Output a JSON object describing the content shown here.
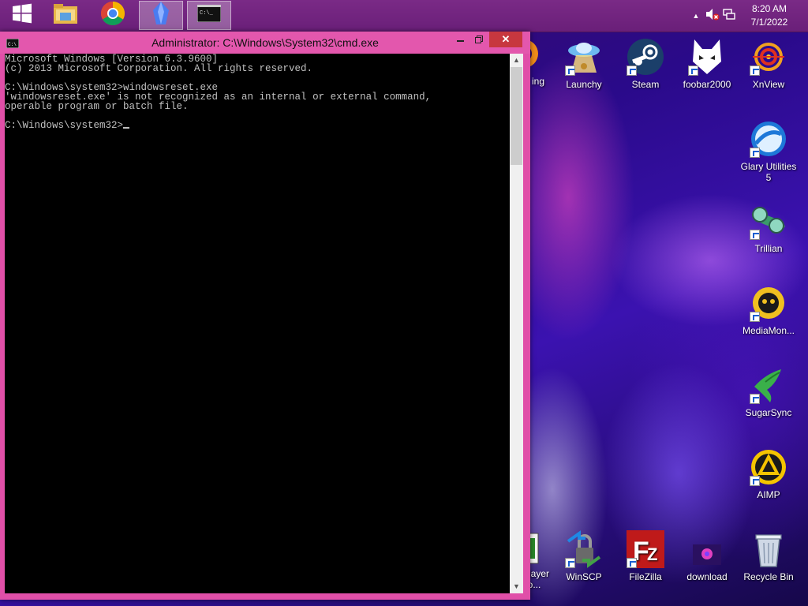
{
  "taskbar": {
    "start": {
      "icon": "windows-logo-icon"
    },
    "pinned": [
      {
        "name": "file-explorer-icon"
      },
      {
        "name": "chrome-icon"
      },
      {
        "name": "crystal-app-icon"
      },
      {
        "name": "command-prompt-icon"
      }
    ],
    "clock": {
      "time": "8:20 AM",
      "date": "7/1/2022"
    }
  },
  "window": {
    "title": "Administrator: C:\\Windows\\System32\\cmd.exe",
    "console_lines": [
      "Microsoft Windows [Version 6.3.9600]",
      "(c) 2013 Microsoft Corporation. All rights reserved.",
      "",
      "C:\\Windows\\system32>windowsreset.exe",
      "'windowsreset.exe' is not recognized as an internal or external command,",
      "operable program or batch file.",
      "",
      "C:\\Windows\\system32>"
    ]
  },
  "desktop_icons": {
    "partial_top": "ing",
    "launchy": "Launchy",
    "steam": "Steam",
    "foobar": "foobar2000",
    "xnview": "XnView",
    "glary": "Glary Utilities 5",
    "trillian": "Trillian",
    "mediamonkey": "MediaMon...",
    "sugarsync": "SugarSync",
    "aimp": "AIMP",
    "partial_bottom": "layer Ho...",
    "winscp": "WinSCP",
    "filezilla": "FileZilla",
    "download": "download",
    "recycle": "Recycle Bin"
  }
}
